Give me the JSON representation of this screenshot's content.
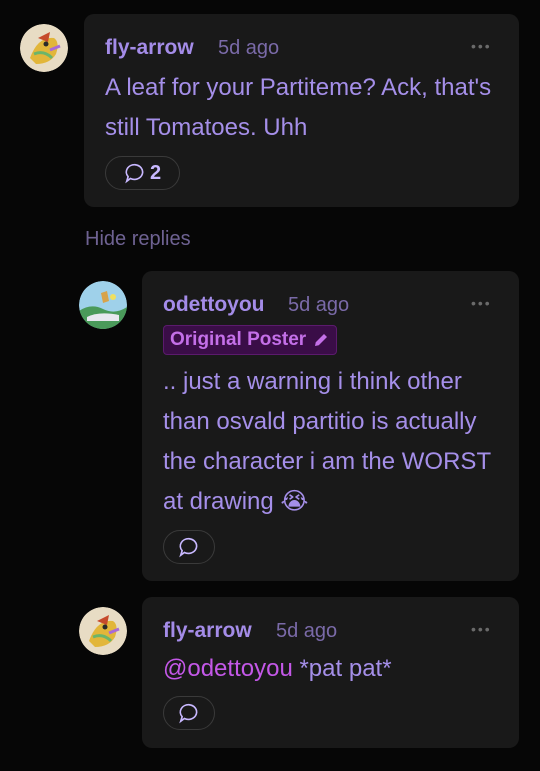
{
  "comments": [
    {
      "username": "fly-arrow",
      "time": "5d ago",
      "more": "•••",
      "text": "A leaf for your Partiteme? Ack, that's still Tomatoes. Uhh",
      "reply_count": "2"
    },
    {
      "username": "odettoyou",
      "time": "5d ago",
      "more": "•••",
      "badge": "Original Poster",
      "text": ".. just a warning i think other than osvald partitio is actually the character i am the WORST at drawing 😭"
    },
    {
      "username": "fly-arrow",
      "time": "5d ago",
      "more": "•••",
      "mention": "@odettoyou",
      "text": "*pat pat*"
    }
  ],
  "hide_replies": "Hide replies",
  "colors": {
    "card": "#191919",
    "username": "#a48ce8",
    "mention": "#c458e8",
    "badge_bg": "#3a0d47"
  },
  "icons": [
    "avatar-bird",
    "avatar-landscape",
    "speech-bubble-icon",
    "pencil-icon",
    "more-dots-icon"
  ]
}
